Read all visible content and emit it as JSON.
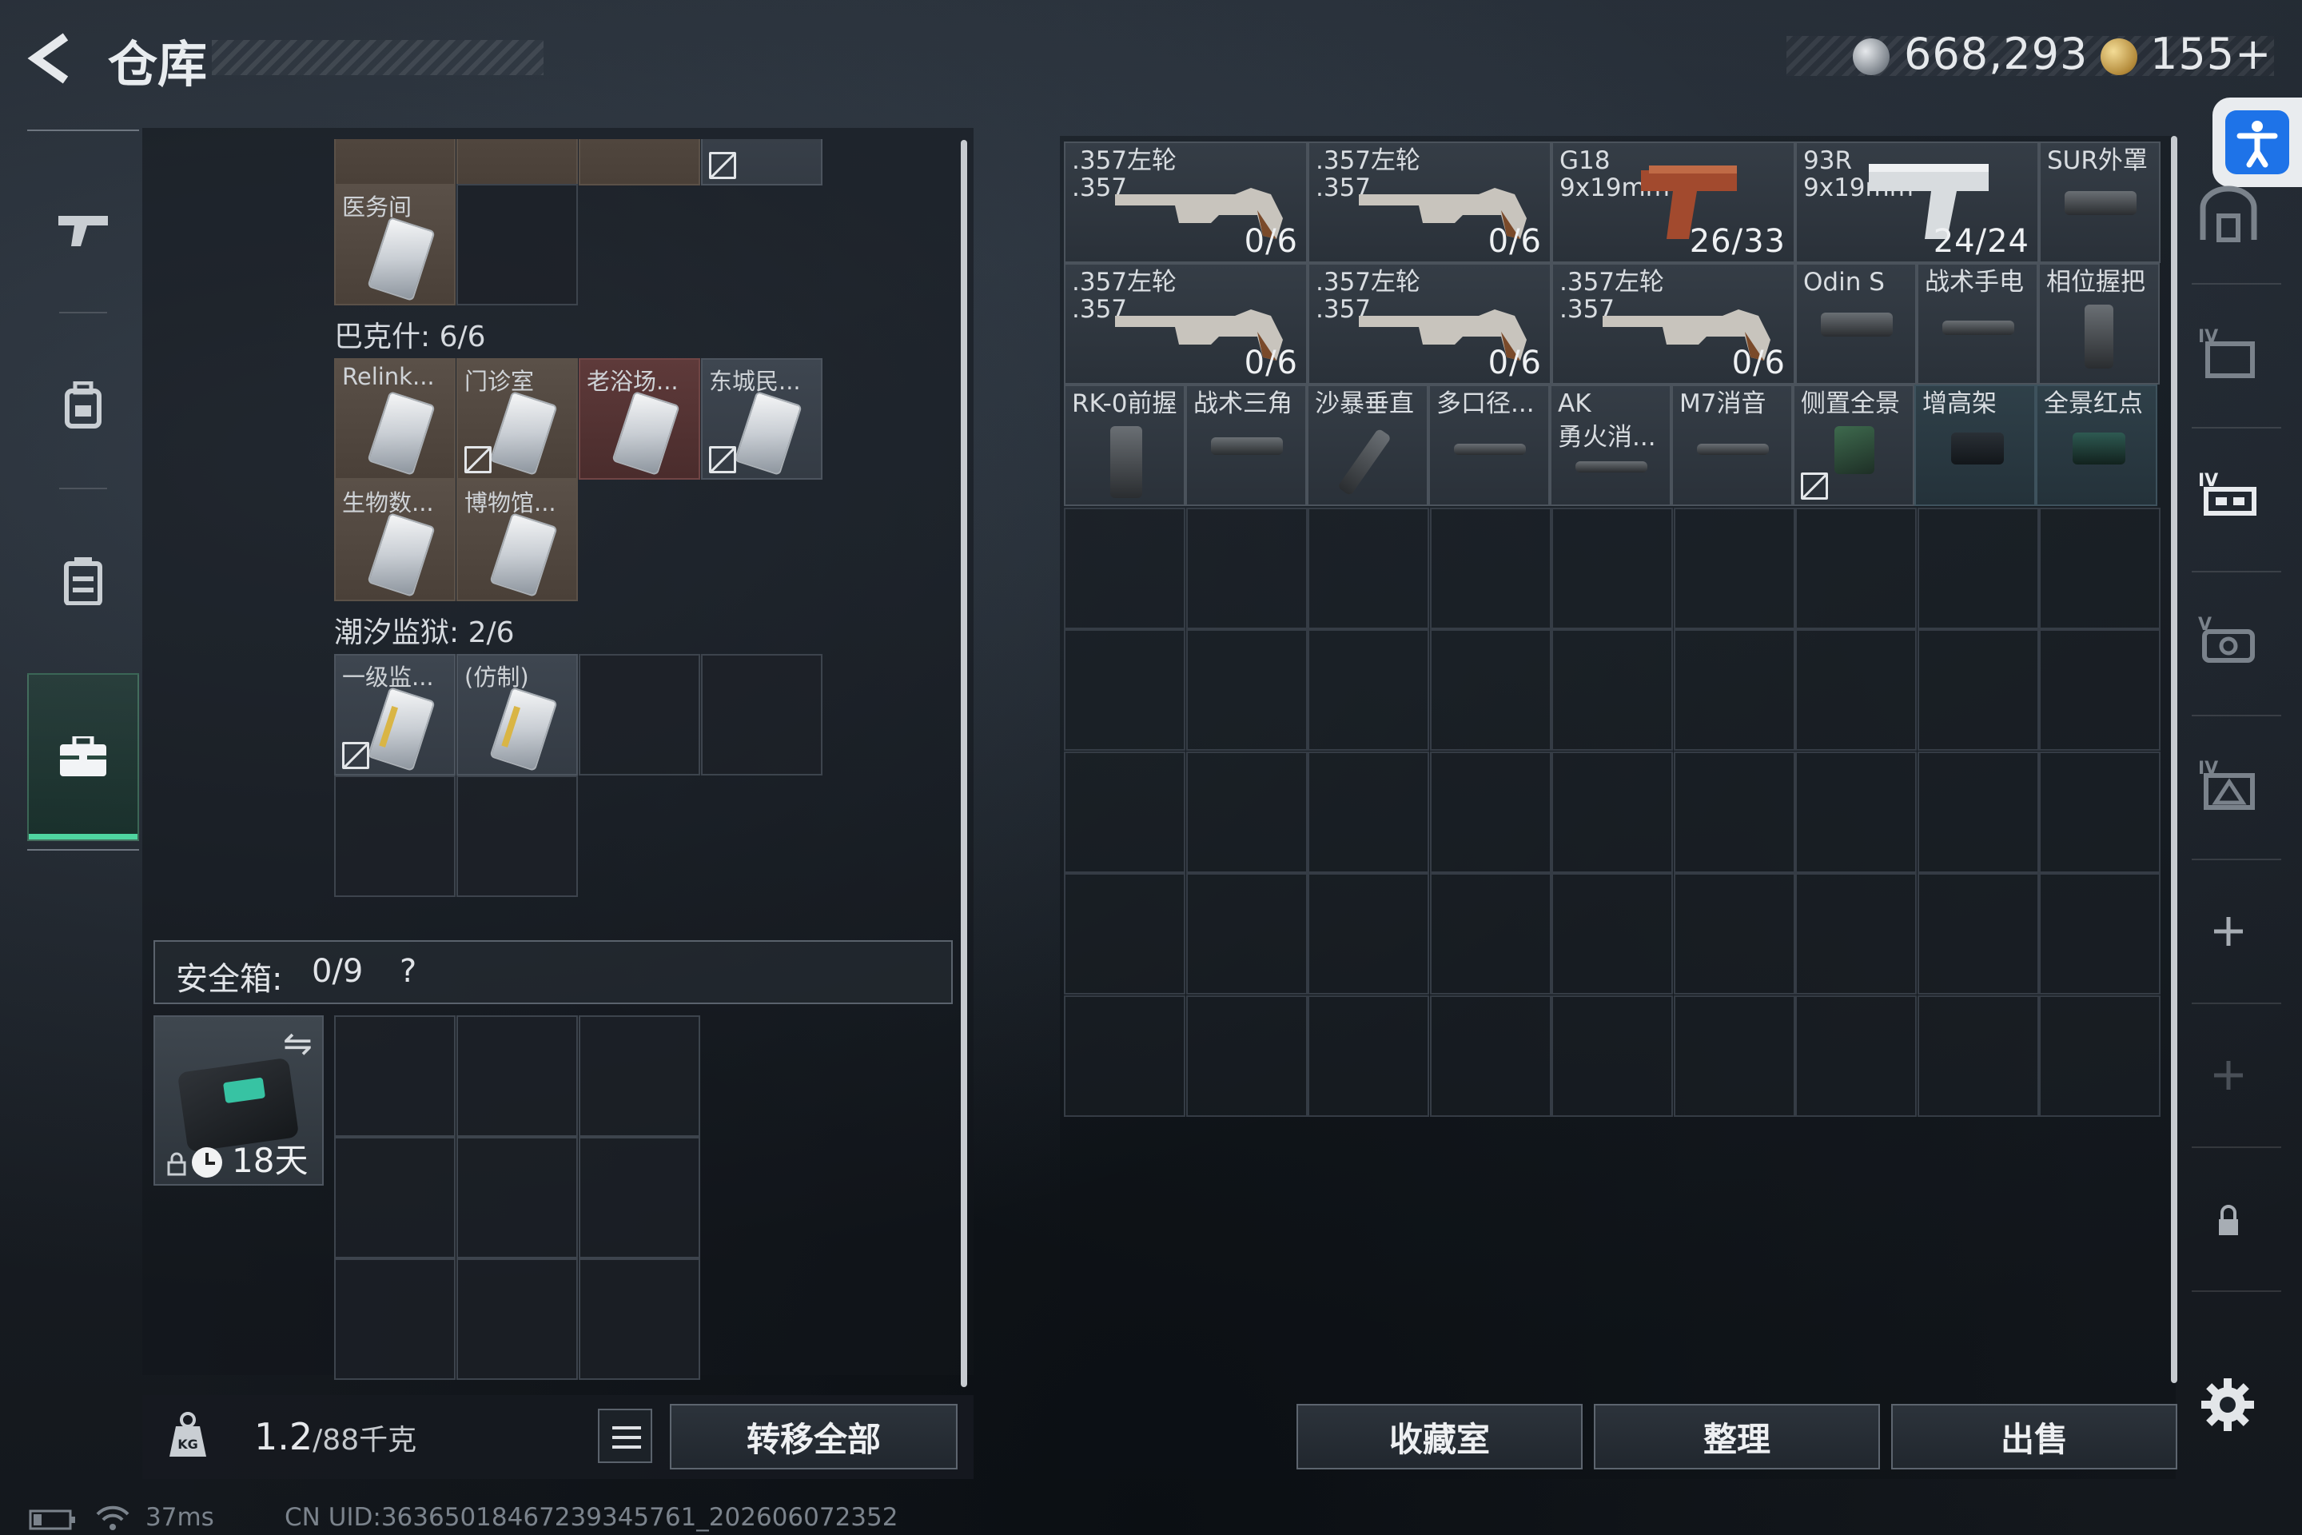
{
  "header": {
    "title": "仓库",
    "currency": {
      "silver": "668,293",
      "gold": "155+"
    }
  },
  "left_nav": {
    "items": [
      "weapon",
      "backpack",
      "chest-rig",
      "secure-case"
    ],
    "active": "secure-case"
  },
  "keycard_holder": {
    "top_cells": [
      {
        "label": "医务间",
        "color": "filled"
      }
    ],
    "sections": [
      {
        "title": "巴克什: 6/6",
        "cards": [
          {
            "label": "Relink...",
            "color": "filled",
            "no_sell": false
          },
          {
            "label": "门诊室",
            "color": "filled",
            "no_sell": true
          },
          {
            "label": "老浴场...",
            "color": "red",
            "no_sell": false
          },
          {
            "label": "东城民...",
            "color": "gray",
            "no_sell": true
          },
          {
            "label": "生物数...",
            "color": "filled",
            "no_sell": false
          },
          {
            "label": "博物馆...",
            "color": "filled",
            "no_sell": false
          }
        ]
      },
      {
        "title": "潮汐监狱: 2/6",
        "cards": [
          {
            "label": "一级监...",
            "color": "gray",
            "no_sell": true
          },
          {
            "label": "(仿制)",
            "color": "gray",
            "no_sell": false
          }
        ]
      }
    ]
  },
  "safebox": {
    "label": "安全箱:",
    "count": "0/9",
    "help": "?",
    "days": "18天"
  },
  "bottom_left": {
    "weight_current": "1.2",
    "weight_max": "/88千克",
    "transfer_all": "转移全部"
  },
  "stash": {
    "rows": [
      [
        {
          "l1": ".357左轮",
          "l2": ".357",
          "ammo": "0/6",
          "kind": "revolver",
          "tone": "default"
        },
        {
          "l1": ".357左轮",
          "l2": ".357",
          "ammo": "0/6",
          "kind": "revolver",
          "tone": "default"
        },
        {
          "l1": "G18",
          "l2": "9x19mm",
          "ammo": "26/33",
          "kind": "pistol-red",
          "tone": "default"
        },
        {
          "l1": "93R",
          "l2": "9x19mm",
          "ammo": "24/24",
          "kind": "pistol-silver",
          "tone": "default"
        },
        {
          "l1": "SUR外罩",
          "l2": "",
          "ammo": "",
          "kind": "part",
          "tone": "default"
        }
      ],
      [
        {
          "l1": ".357左轮",
          "l2": ".357",
          "ammo": "0/6",
          "kind": "revolver",
          "tone": "default"
        },
        {
          "l1": ".357左轮",
          "l2": ".357",
          "ammo": "0/6",
          "kind": "revolver",
          "tone": "default"
        },
        {
          "l1": ".357左轮",
          "l2": ".357",
          "ammo": "0/6",
          "kind": "revolver",
          "tone": "default"
        },
        {
          "l1": "Odin S",
          "l2": "",
          "ammo": "",
          "kind": "part",
          "tone": "default"
        },
        {
          "l1": "战术手电",
          "l2": "",
          "ammo": "",
          "kind": "part",
          "tone": "default"
        },
        {
          "l1": "相位握把",
          "l2": "",
          "ammo": "",
          "kind": "grip",
          "tone": "default"
        }
      ],
      [
        {
          "l1": "RK-0前握",
          "l2": "",
          "ammo": "",
          "kind": "grip",
          "tone": "default"
        },
        {
          "l1": "战术三角",
          "l2": "",
          "ammo": "",
          "kind": "part",
          "tone": "default"
        },
        {
          "l1": "沙暴垂直",
          "l2": "",
          "ammo": "",
          "kind": "stick",
          "tone": "default"
        },
        {
          "l1": "多口径...",
          "l2": "",
          "ammo": "",
          "kind": "part",
          "tone": "default"
        },
        {
          "l1": "AK",
          "l2": "勇火消...",
          "ammo": "",
          "kind": "part",
          "tone": "default"
        },
        {
          "l1": "M7消音",
          "l2": "",
          "ammo": "",
          "kind": "part",
          "tone": "default"
        },
        {
          "l1": "侧置全景",
          "l2": "",
          "ammo": "",
          "kind": "scope",
          "tone": "default",
          "no_sell": true
        },
        {
          "l1": "增高架",
          "l2": "",
          "ammo": "",
          "kind": "mount",
          "tone": "teal"
        },
        {
          "l1": "全景红点",
          "l2": "",
          "ammo": "",
          "kind": "scope",
          "tone": "teal"
        }
      ]
    ],
    "buttons": {
      "collection": "收藏室",
      "sort": "整理",
      "sell": "出售"
    }
  },
  "right_nav": {
    "items": [
      "shelter",
      "iv-case",
      "iv-rig",
      "v-armor",
      "iv-tent",
      "add",
      "add-disabled",
      "lock",
      "settings"
    ]
  },
  "status_bar": {
    "ping": "37ms",
    "uid": "CN UID:36365018467239345761_202606072352"
  }
}
